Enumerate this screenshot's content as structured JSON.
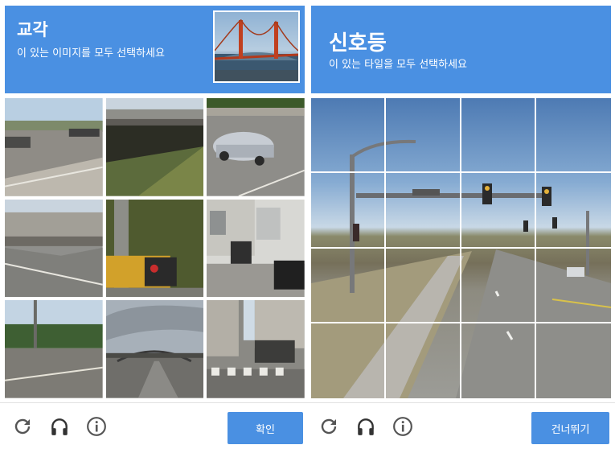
{
  "left": {
    "title": "교각",
    "subtitle": "이 있는 이미지를 모두 선택하세요",
    "confirm_label": "확인"
  },
  "right": {
    "title": "신호등",
    "subtitle": "이 있는 타일을 모두 선택하세요",
    "skip_label": "건너뛰기"
  },
  "footer_icons": [
    "reload-icon",
    "audio-icon",
    "info-icon"
  ],
  "colors": {
    "accent": "#4a90e2",
    "header_text": "#ffffff",
    "icon": "#555555"
  }
}
